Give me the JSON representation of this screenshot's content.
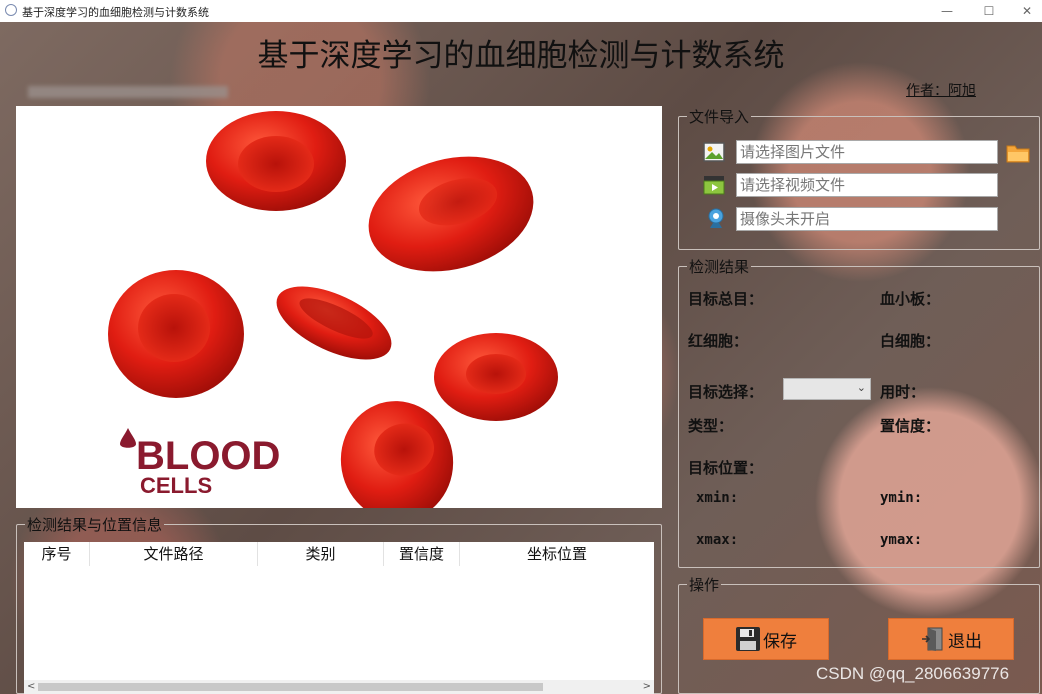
{
  "window": {
    "title": "基于深度学习的血细胞检测与计数系统",
    "minimize": "—",
    "maximize": "☐",
    "close": "✕"
  },
  "header": {
    "title": "基于深度学习的血细胞检测与计数系统",
    "author": "作者：阿旭"
  },
  "preview": {
    "brand_line1": "BLOOD",
    "brand_line2": "CELLS"
  },
  "import": {
    "legend": "文件导入",
    "image_placeholder": "请选择图片文件",
    "video_placeholder": "请选择视频文件",
    "camera_placeholder": "摄像头未开启"
  },
  "result": {
    "legend": "检测结果",
    "total_label": "目标总目：",
    "platelet_label": "血小板：",
    "rbc_label": "红细胞：",
    "wbc_label": "白细胞：",
    "target_select_label": "目标选择：",
    "time_label": "用时：",
    "type_label": "类型：",
    "confidence_label": "置信度：",
    "position_label": "目标位置：",
    "xmin_label": "xmin:",
    "ymin_label": "ymin:",
    "xmax_label": "xmax:",
    "ymax_label": "ymax:"
  },
  "ops": {
    "legend": "操作",
    "save": "保存",
    "exit": "退出"
  },
  "table": {
    "legend": "检测结果与位置信息",
    "columns": [
      "序号",
      "文件路径",
      "类别",
      "置信度",
      "坐标位置"
    ]
  },
  "watermark": "CSDN @qq_2806639776",
  "colors": {
    "button": "#ef7f3d",
    "cell_red": "#d61f14",
    "brand": "#8a1a2e"
  }
}
